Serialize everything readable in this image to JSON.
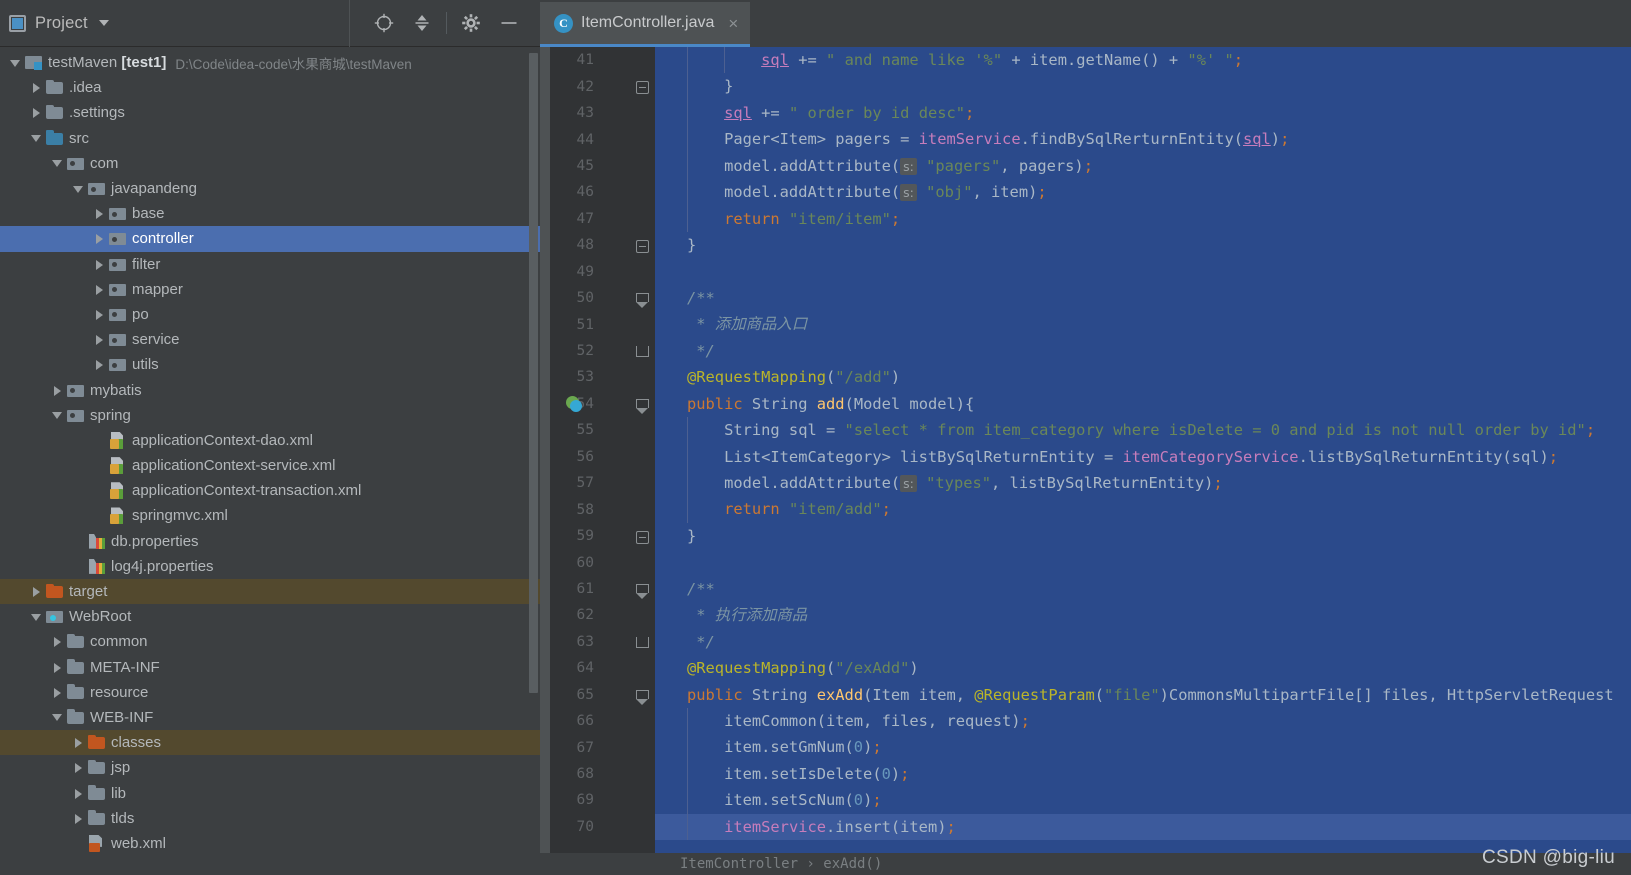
{
  "project_panel": {
    "header": {
      "title": "Project",
      "dropdown_icon": "chevron-down-icon",
      "actions": [
        {
          "name": "locate-icon",
          "glyph": "locate"
        },
        {
          "name": "collapse-all-icon",
          "glyph": "collapse"
        },
        {
          "name": "gear-icon",
          "glyph": "gear"
        },
        {
          "name": "hide-icon",
          "glyph": "minus"
        }
      ]
    },
    "tree": [
      {
        "depth": 0,
        "arrow": "down",
        "icon": "module",
        "label": "testMaven",
        "bold": "[test1]",
        "path": "D:\\Code\\idea-code\\水果商城\\testMaven",
        "state": "normal"
      },
      {
        "depth": 1,
        "arrow": "right",
        "icon": "folder",
        "label": ".idea",
        "state": "normal"
      },
      {
        "depth": 1,
        "arrow": "right",
        "icon": "folder",
        "label": ".settings",
        "state": "normal"
      },
      {
        "depth": 1,
        "arrow": "down",
        "icon": "folder-src",
        "label": "src",
        "state": "normal"
      },
      {
        "depth": 2,
        "arrow": "down",
        "icon": "package",
        "label": "com",
        "state": "normal"
      },
      {
        "depth": 3,
        "arrow": "down",
        "icon": "package",
        "label": "javapandeng",
        "state": "normal"
      },
      {
        "depth": 4,
        "arrow": "right",
        "icon": "package",
        "label": "base",
        "state": "normal"
      },
      {
        "depth": 4,
        "arrow": "right",
        "icon": "package",
        "label": "controller",
        "state": "selected"
      },
      {
        "depth": 4,
        "arrow": "right",
        "icon": "package",
        "label": "filter",
        "state": "normal"
      },
      {
        "depth": 4,
        "arrow": "right",
        "icon": "package",
        "label": "mapper",
        "state": "normal"
      },
      {
        "depth": 4,
        "arrow": "right",
        "icon": "package",
        "label": "po",
        "state": "normal"
      },
      {
        "depth": 4,
        "arrow": "right",
        "icon": "package",
        "label": "service",
        "state": "normal"
      },
      {
        "depth": 4,
        "arrow": "right",
        "icon": "package",
        "label": "utils",
        "state": "normal"
      },
      {
        "depth": 2,
        "arrow": "right",
        "icon": "package",
        "label": "mybatis",
        "state": "normal"
      },
      {
        "depth": 2,
        "arrow": "down",
        "icon": "package",
        "label": "spring",
        "state": "normal"
      },
      {
        "depth": 4,
        "arrow": "none",
        "icon": "xml",
        "label": "applicationContext-dao.xml",
        "state": "normal"
      },
      {
        "depth": 4,
        "arrow": "none",
        "icon": "xml",
        "label": "applicationContext-service.xml",
        "state": "normal"
      },
      {
        "depth": 4,
        "arrow": "none",
        "icon": "xml",
        "label": "applicationContext-transaction.xml",
        "state": "normal"
      },
      {
        "depth": 4,
        "arrow": "none",
        "icon": "xml",
        "label": "springmvc.xml",
        "state": "normal"
      },
      {
        "depth": 3,
        "arrow": "none",
        "icon": "properties",
        "label": "db.properties",
        "state": "normal"
      },
      {
        "depth": 3,
        "arrow": "none",
        "icon": "properties",
        "label": "log4j.properties",
        "state": "normal"
      },
      {
        "depth": 1,
        "arrow": "right",
        "icon": "folder-orange",
        "label": "target",
        "state": "excluded"
      },
      {
        "depth": 1,
        "arrow": "down",
        "icon": "webroot",
        "label": "WebRoot",
        "state": "normal"
      },
      {
        "depth": 2,
        "arrow": "right",
        "icon": "folder",
        "label": "common",
        "state": "normal"
      },
      {
        "depth": 2,
        "arrow": "right",
        "icon": "folder",
        "label": "META-INF",
        "state": "normal"
      },
      {
        "depth": 2,
        "arrow": "right",
        "icon": "folder",
        "label": "resource",
        "state": "normal"
      },
      {
        "depth": 2,
        "arrow": "down",
        "icon": "folder",
        "label": "WEB-INF",
        "state": "normal"
      },
      {
        "depth": 3,
        "arrow": "right",
        "icon": "folder-orange",
        "label": "classes",
        "state": "excluded"
      },
      {
        "depth": 3,
        "arrow": "right",
        "icon": "folder",
        "label": "jsp",
        "state": "normal"
      },
      {
        "depth": 3,
        "arrow": "right",
        "icon": "folder",
        "label": "lib",
        "state": "normal"
      },
      {
        "depth": 3,
        "arrow": "right",
        "icon": "folder",
        "label": "tlds",
        "state": "normal"
      },
      {
        "depth": 3,
        "arrow": "none",
        "icon": "web-xml",
        "label": "web.xml",
        "state": "normal"
      }
    ]
  },
  "editor": {
    "tab": {
      "label": "ItemController.java",
      "icon": "java-class-icon",
      "close": "×"
    },
    "breadcrumb": "ItemController  ›  exAdd()",
    "first_line": 41,
    "caret_line": 70,
    "lines": [
      {
        "n": 41,
        "fold": "none",
        "bean": false,
        "indent": 2,
        "html": "        <span class=\"fld ul\">sql</span> += <span class=\"s\">\" and name like '%\"</span> + item.getName() + <span class=\"s\">\"%' \"</span><span class=\"sem\">;</span>"
      },
      {
        "n": 42,
        "fold": "minus",
        "bean": false,
        "indent": 1,
        "html": "    }"
      },
      {
        "n": 43,
        "fold": "none",
        "bean": false,
        "indent": 1,
        "html": "    <span class=\"fld ul\">sql</span> += <span class=\"s\">\" order by id desc\"</span><span class=\"sem\">;</span>"
      },
      {
        "n": 44,
        "fold": "none",
        "bean": false,
        "indent": 1,
        "html": "    Pager&lt;Item&gt; pagers = <span class=\"fld\">itemService</span>.findBySqlRerturnEntity(<span class=\"fld ul\">sql</span>)<span class=\"sem\">;</span>"
      },
      {
        "n": 45,
        "fold": "none",
        "bean": false,
        "indent": 1,
        "html": "    model.addAttribute(<span class=\"hint\">s:</span> <span class=\"s\">\"pagers\"</span>, pagers)<span class=\"sem\">;</span>"
      },
      {
        "n": 46,
        "fold": "none",
        "bean": false,
        "indent": 1,
        "html": "    model.addAttribute(<span class=\"hint\">s:</span> <span class=\"s\">\"obj\"</span>, item)<span class=\"sem\">;</span>"
      },
      {
        "n": 47,
        "fold": "none",
        "bean": false,
        "indent": 1,
        "html": "    <span class=\"k\">return</span> <span class=\"s\">\"item/item\"</span><span class=\"sem\">;</span>"
      },
      {
        "n": 48,
        "fold": "minus",
        "bean": false,
        "indent": 0,
        "html": "}"
      },
      {
        "n": 49,
        "fold": "none",
        "bean": false,
        "indent": 0,
        "html": ""
      },
      {
        "n": 50,
        "fold": "arrowdn",
        "bean": false,
        "indent": 0,
        "html": "<span class=\"cm\">/**</span>"
      },
      {
        "n": 51,
        "fold": "none",
        "bean": false,
        "indent": 0,
        "html": "<span class=\"cm\"> * 添加商品入口</span>"
      },
      {
        "n": 52,
        "fold": "tick",
        "bean": false,
        "indent": 0,
        "html": "<span class=\"cm\"> */</span>"
      },
      {
        "n": 53,
        "fold": "none",
        "bean": false,
        "indent": 0,
        "html": "<span class=\"an\">@RequestMapping</span>(<span class=\"s\">\"/add\"</span>)"
      },
      {
        "n": 54,
        "fold": "arrowdn",
        "bean": true,
        "indent": 0,
        "html": "<span class=\"k\">public</span> String <span class=\"mth\">add</span>(Model model){"
      },
      {
        "n": 55,
        "fold": "none",
        "bean": false,
        "indent": 1,
        "html": "    String sql = <span class=\"s\">\"select * from item_category where isDelete = 0 and pid is not null order by id\"</span><span class=\"sem\">;</span>"
      },
      {
        "n": 56,
        "fold": "none",
        "bean": false,
        "indent": 1,
        "html": "    List&lt;ItemCategory&gt; listBySqlReturnEntity = <span class=\"fld\">itemCategoryService</span>.listBySqlReturnEntity(sql)<span class=\"sem\">;</span>"
      },
      {
        "n": 57,
        "fold": "none",
        "bean": false,
        "indent": 1,
        "html": "    model.addAttribute(<span class=\"hint\">s:</span> <span class=\"s\">\"types\"</span>, listBySqlReturnEntity)<span class=\"sem\">;</span>"
      },
      {
        "n": 58,
        "fold": "none",
        "bean": false,
        "indent": 1,
        "html": "    <span class=\"k\">return</span> <span class=\"s\">\"item/add\"</span><span class=\"sem\">;</span>"
      },
      {
        "n": 59,
        "fold": "minus",
        "bean": false,
        "indent": 0,
        "html": "}"
      },
      {
        "n": 60,
        "fold": "none",
        "bean": false,
        "indent": 0,
        "html": ""
      },
      {
        "n": 61,
        "fold": "arrowdn",
        "bean": false,
        "indent": 0,
        "html": "<span class=\"cm\">/**</span>"
      },
      {
        "n": 62,
        "fold": "none",
        "bean": false,
        "indent": 0,
        "html": "<span class=\"cm\"> * 执行添加商品</span>"
      },
      {
        "n": 63,
        "fold": "tick",
        "bean": false,
        "indent": 0,
        "html": "<span class=\"cm\"> */</span>"
      },
      {
        "n": 64,
        "fold": "none",
        "bean": false,
        "indent": 0,
        "html": "<span class=\"an\">@RequestMapping</span>(<span class=\"s\">\"/exAdd\"</span>)"
      },
      {
        "n": 65,
        "fold": "arrowdn",
        "bean": false,
        "indent": 0,
        "html": "<span class=\"k\">public</span> String <span class=\"mth\">exAdd</span>(Item item, <span class=\"an\">@RequestParam</span>(<span class=\"s\">\"file\"</span>)CommonsMultipartFile[] files, HttpServletRequest"
      },
      {
        "n": 66,
        "fold": "none",
        "bean": false,
        "indent": 1,
        "html": "    itemCommon(item, files, request)<span class=\"sem\">;</span>"
      },
      {
        "n": 67,
        "fold": "none",
        "bean": false,
        "indent": 1,
        "html": "    item.setGmNum(<span class=\"num\">0</span>)<span class=\"sem\">;</span>"
      },
      {
        "n": 68,
        "fold": "none",
        "bean": false,
        "indent": 1,
        "html": "    item.setIsDelete(<span class=\"num\">0</span>)<span class=\"sem\">;</span>"
      },
      {
        "n": 69,
        "fold": "none",
        "bean": false,
        "indent": 1,
        "html": "    item.setScNum(<span class=\"num\">0</span>)<span class=\"sem\">;</span>"
      },
      {
        "n": 70,
        "fold": "none",
        "bean": false,
        "indent": 1,
        "html": "    <span class=\"fld\">itemService</span>.insert(item)<span class=\"sem\">;</span>"
      }
    ]
  },
  "watermark": "CSDN @big-liu",
  "colors": {
    "panel_bg": "#3c3f41",
    "gutter_bg": "#313335",
    "code_selection_bg": "#2b4a8b",
    "caret_row_bg": "#3c5a9c",
    "tree_selection_bg": "#4b6eaf",
    "excluded_row_bg": "#53492e",
    "tab_underline": "#4a88c7",
    "keyword": "#cc7832",
    "string": "#6a8759",
    "comment": "#7b94a3",
    "annotation": "#bbb529",
    "method": "#ffc66d",
    "field": "#c77dbb",
    "number": "#6897bb",
    "text": "#a9b7c6"
  }
}
